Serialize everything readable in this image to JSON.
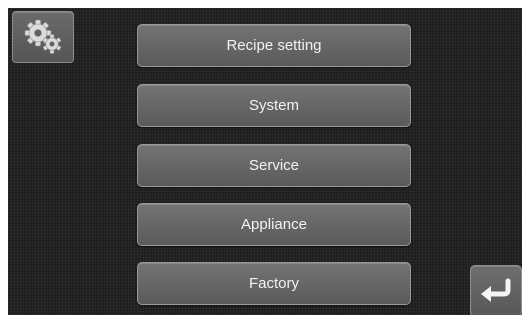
{
  "toolbar": {
    "settings_icon": "gear-icon",
    "back_icon": "return-arrow-icon"
  },
  "menu": {
    "items": [
      {
        "label": "Recipe setting"
      },
      {
        "label": "System"
      },
      {
        "label": "Service"
      },
      {
        "label": "Appliance"
      },
      {
        "label": "Factory"
      }
    ]
  },
  "colors": {
    "background": "#1e1e1e",
    "button": "#676767",
    "button_border": "#999999",
    "text": "#f2f2f2"
  }
}
